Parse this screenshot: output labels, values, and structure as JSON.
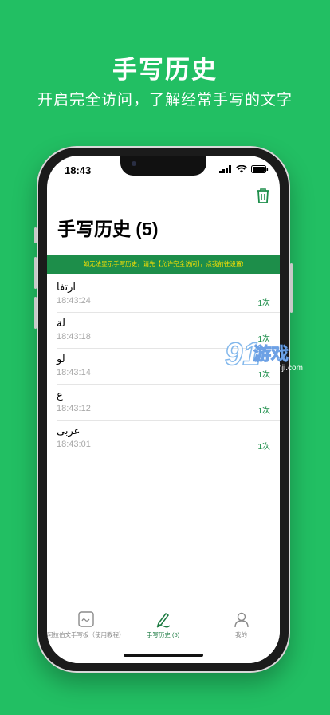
{
  "promo": {
    "title": "手写历史",
    "subtitle": "开启完全访问，了解经常手写的文字"
  },
  "status_bar": {
    "time": "18:43"
  },
  "header": {
    "title": "手写历史 (5)"
  },
  "banner": {
    "text": "如无法显示手写历史，请先【允许完全访问】，点我前往设置!"
  },
  "history": [
    {
      "text": "ارتفا",
      "time": "18:43:24",
      "count": "1次"
    },
    {
      "text": "لة",
      "time": "18:43:18",
      "count": "1次"
    },
    {
      "text": "لو",
      "time": "18:43:14",
      "count": "1次"
    },
    {
      "text": "ع",
      "time": "18:43:12",
      "count": "1次"
    },
    {
      "text": "عربى",
      "time": "18:43:01",
      "count": "1次"
    }
  ],
  "tabs": [
    {
      "label": "阿拉伯文手写板（使用教程）",
      "icon": "keyboard-pad-icon",
      "active": false
    },
    {
      "label": "手写历史 (5)",
      "icon": "pen-icon",
      "active": true
    },
    {
      "label": "我的",
      "icon": "person-icon",
      "active": false
    }
  ],
  "watermark": {
    "number": "91",
    "brand": "游戏",
    "url": "91danji.com"
  },
  "colors": {
    "brand_green": "#22bf63",
    "dark_green": "#1d8e4a",
    "banner_text": "#ffe200"
  }
}
